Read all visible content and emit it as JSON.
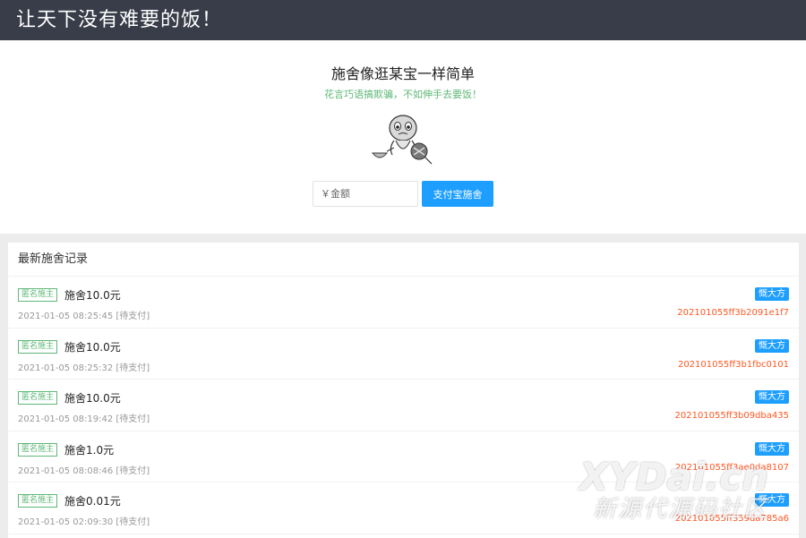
{
  "header": {
    "title": "让天下没有难要的饭！"
  },
  "hero": {
    "title": "施舍像逛某宝一样简单",
    "subtitle": "花言巧语搞欺骗，不如伸手去要饭！"
  },
  "donate": {
    "amount_placeholder": "￥金额",
    "pay_button": "支付宝施舍"
  },
  "records": {
    "title": "最新施舍记录",
    "items": [
      {
        "tag": "匿名施主",
        "amount": "施舍10.0元",
        "time": "2021-01-05 08:25:45",
        "status": "[待支付]",
        "badge": "慨大方",
        "order": "202101055ff3b2091e1f7"
      },
      {
        "tag": "匿名施主",
        "amount": "施舍10.0元",
        "time": "2021-01-05 08:25:32",
        "status": "[待支付]",
        "badge": "慨大方",
        "order": "202101055ff3b1fbc0101"
      },
      {
        "tag": "匿名施主",
        "amount": "施舍10.0元",
        "time": "2021-01-05 08:19:42",
        "status": "[待支付]",
        "badge": "慨大方",
        "order": "202101055ff3b09dba435"
      },
      {
        "tag": "匿名施主",
        "amount": "施舍1.0元",
        "time": "2021-01-05 08:08:46",
        "status": "[待支付]",
        "badge": "慨大方",
        "order": "202101055ff3ae0da8107"
      },
      {
        "tag": "匿名施主",
        "amount": "施舍0.01元",
        "time": "2021-01-05 02:09:30",
        "status": "[待支付]",
        "badge": "慨大方",
        "order": "202101055ff359da785a6"
      }
    ]
  },
  "watermark": {
    "main": "XYDai.cn",
    "sub": "新源代源码社区"
  }
}
